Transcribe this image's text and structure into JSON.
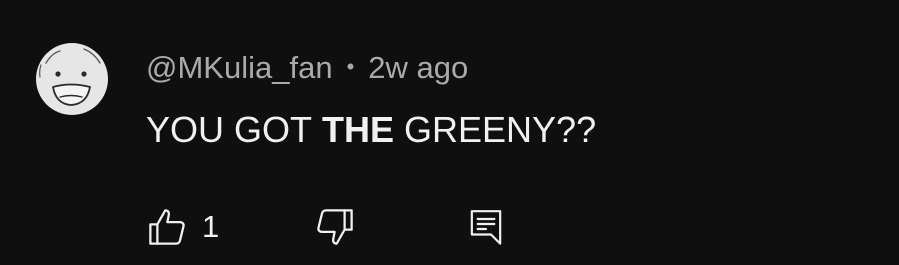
{
  "comment": {
    "author": "@MKulia_fan",
    "separator": "•",
    "timestamp": "2w ago",
    "text_before": "YOU GOT",
    "text_bold": "THE",
    "text_after": "GREENY??",
    "like_count": "1",
    "avatar_icon": "smiley-face-avatar",
    "like_icon": "thumbs-up-icon",
    "dislike_icon": "thumbs-down-icon",
    "reply_icon": "reply-comment-icon"
  },
  "colors": {
    "background": "#0f0f0f",
    "primary_text": "#f1f1f1",
    "secondary_text": "#aaaaaa",
    "avatar_fill": "#e6e6e6"
  }
}
